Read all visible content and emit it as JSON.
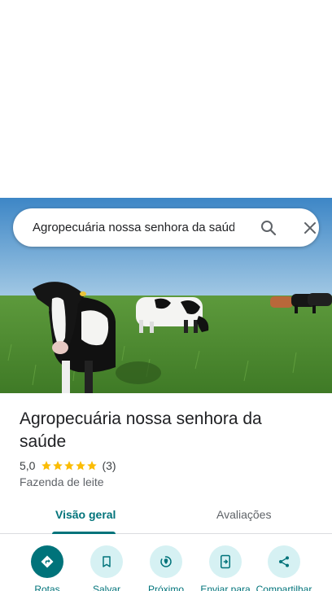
{
  "search": {
    "query": "Agropecuária nossa senhora da saúde"
  },
  "place": {
    "title": "Agropecuária nossa senhora da saúde",
    "rating": "5,0",
    "rating_value": 5,
    "review_count": "(3)",
    "category": "Fazenda de leite"
  },
  "tabs": [
    {
      "label": "Visão geral",
      "selected": true
    },
    {
      "label": "Avaliações",
      "selected": false
    }
  ],
  "actions": [
    {
      "label": "Rotas",
      "icon": "directions-icon"
    },
    {
      "label": "Salvar",
      "icon": "bookmark-icon"
    },
    {
      "label": "Próximo",
      "icon": "nearby-icon"
    },
    {
      "label": "Enviar para",
      "icon": "send-to-phone-icon"
    },
    {
      "label": "Compartilhar",
      "icon": "share-icon"
    }
  ],
  "colors": {
    "accent": "#00737a",
    "accent_light": "#d6f1f3",
    "star": "#fbbc04"
  }
}
